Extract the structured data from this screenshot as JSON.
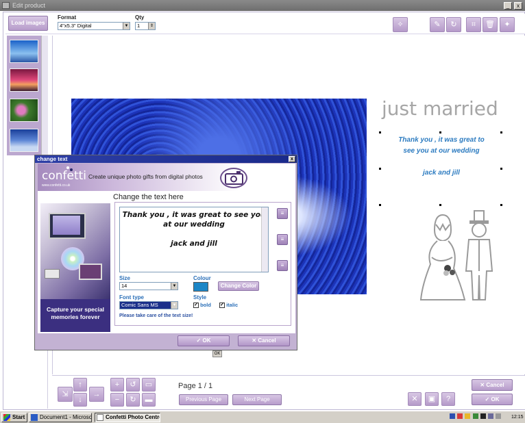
{
  "window": {
    "title": "Edit product",
    "min_label": "_",
    "close_label": "x"
  },
  "toolbar": {
    "load_images_label": "Load images",
    "format_label": "Format",
    "format_value": "4\"x5.3\" Digital",
    "qty_label": "Qty",
    "qty_value": "1",
    "right_icons": [
      "wand-icon",
      "pencil-icon",
      "rotate-icon",
      "crop-icon",
      "trash-icon",
      "magic-icon"
    ]
  },
  "thumbnails": [
    "blue-sky-thumbnail",
    "sunset-thumbnail",
    "flowers-thumbnail",
    "winter-thumbnail"
  ],
  "card": {
    "heading": "just married",
    "lines": [
      "Thank you , it was great to",
      "see you at our wedding",
      "jack and jill"
    ],
    "colors": {
      "heading": "#a6a6a6",
      "text": "#2c7bc0",
      "photo": "#1e35c8"
    }
  },
  "dialog": {
    "title": "change text",
    "close_label": "x",
    "brand": "confetti",
    "brand_url": "www.confetti.co.uk",
    "tagline": "Create unique photo gifts from digital photos",
    "heading": "Change the text here",
    "text_lines": [
      "Thank you , it was great to see you",
      "at our wedding",
      "",
      "jack and jill"
    ],
    "size_label": "Size",
    "size_value": "14",
    "colour_label": "Colour",
    "colour_value": "#1c86c6",
    "change_colour_label": "Change Color",
    "font_type_label": "Font type",
    "font_type_value": "Comic Sans MS",
    "style_label": "Style",
    "bold_label": "bold",
    "italic_label": "italic",
    "warning": "Please take care of the text size!",
    "photo_caption": "Capture your special memories forever",
    "ok_label": "OK",
    "cancel_label": "Cancel",
    "small_ok": "OK"
  },
  "bottom": {
    "page_text": "Page 1 / 1",
    "prev_label": "Previous Page",
    "next_label": "Next Page",
    "cancel_label": "Cancel",
    "ok_label": "OK"
  },
  "taskbar": {
    "start_label": "Start",
    "tasks": [
      "Document1 - Microsoft ...",
      "Confetti Photo Centre"
    ],
    "clock": "12:15"
  }
}
